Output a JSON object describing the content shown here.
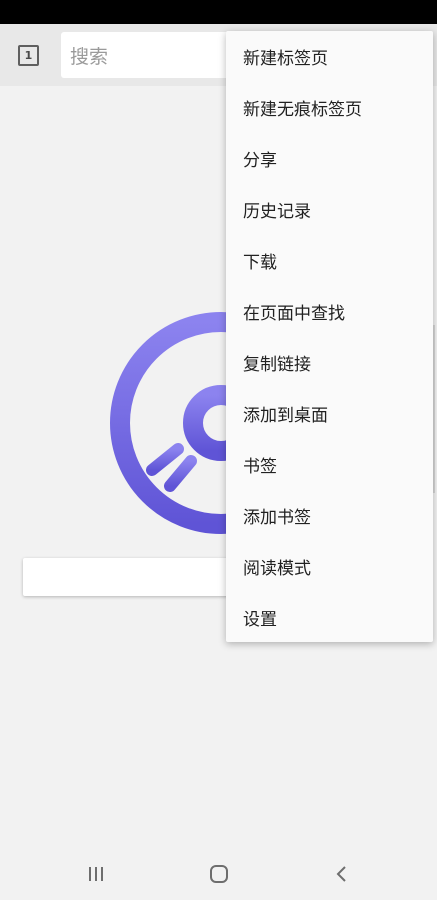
{
  "toolbar": {
    "tab_count": "1",
    "search_placeholder": "搜索"
  },
  "menu": {
    "items": [
      {
        "label": "新建标签页"
      },
      {
        "label": "新建无痕标签页"
      },
      {
        "label": "分享"
      },
      {
        "label": "历史记录"
      },
      {
        "label": "下载"
      },
      {
        "label": "在页面中查找"
      },
      {
        "label": "复制链接"
      },
      {
        "label": "添加到桌面"
      },
      {
        "label": "书签"
      },
      {
        "label": "添加书签"
      },
      {
        "label": "阅读模式"
      },
      {
        "label": "设置"
      }
    ]
  },
  "colors": {
    "status_bar": "#000000",
    "toolbar": "#e8e8e8",
    "background": "#f2f2f2",
    "logo_light": "#8c83ef",
    "logo_dark": "#5f54d6",
    "menu_bg": "#fafafa"
  },
  "icons": {
    "tab_switcher": "square-number-icon",
    "logo": "disc-logo-icon",
    "nav_recent": "recent-apps-icon",
    "nav_home": "home-icon",
    "nav_back": "back-icon"
  }
}
